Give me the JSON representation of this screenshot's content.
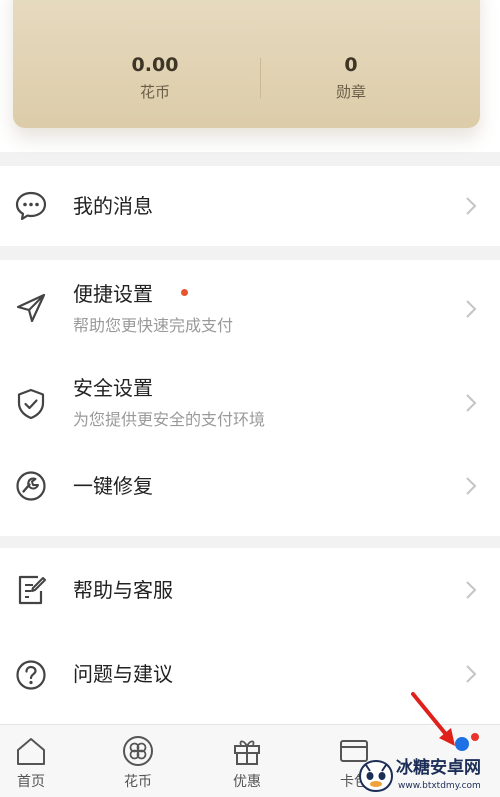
{
  "account": {
    "huabi_value": "0.00",
    "huabi_label": "花币",
    "badge_value": "0",
    "badge_label": "勋章"
  },
  "menu": {
    "messages": {
      "title": "我的消息",
      "icon": "message-bubble-icon"
    },
    "quick_settings": {
      "title": "便捷设置",
      "subtitle": "帮助您更快速完成支付",
      "icon": "paper-plane-icon",
      "has_red_dot": true
    },
    "security_settings": {
      "title": "安全设置",
      "subtitle": "为您提供更安全的支付环境",
      "icon": "shield-check-icon"
    },
    "one_click_repair": {
      "title": "一键修复",
      "icon": "wrench-repair-icon"
    },
    "help_service": {
      "title": "帮助与客服",
      "icon": "edit-document-icon"
    },
    "feedback": {
      "title": "问题与建议",
      "icon": "question-circle-icon"
    }
  },
  "tabbar": {
    "tabs": [
      {
        "label": "首页",
        "icon": "home-icon"
      },
      {
        "label": "花币",
        "icon": "flower-coin-icon"
      },
      {
        "label": "优惠",
        "icon": "gift-icon"
      },
      {
        "label": "卡包",
        "icon": "card-icon"
      }
    ],
    "mine_icon": "mine-dot-icon"
  },
  "watermark": {
    "name": "冰糖安卓网",
    "url": "www.btxtdmy.com"
  },
  "colors": {
    "accent_red": "#e8542c",
    "gold_card": "#dccca9",
    "active_blue": "#1f6fe5"
  }
}
